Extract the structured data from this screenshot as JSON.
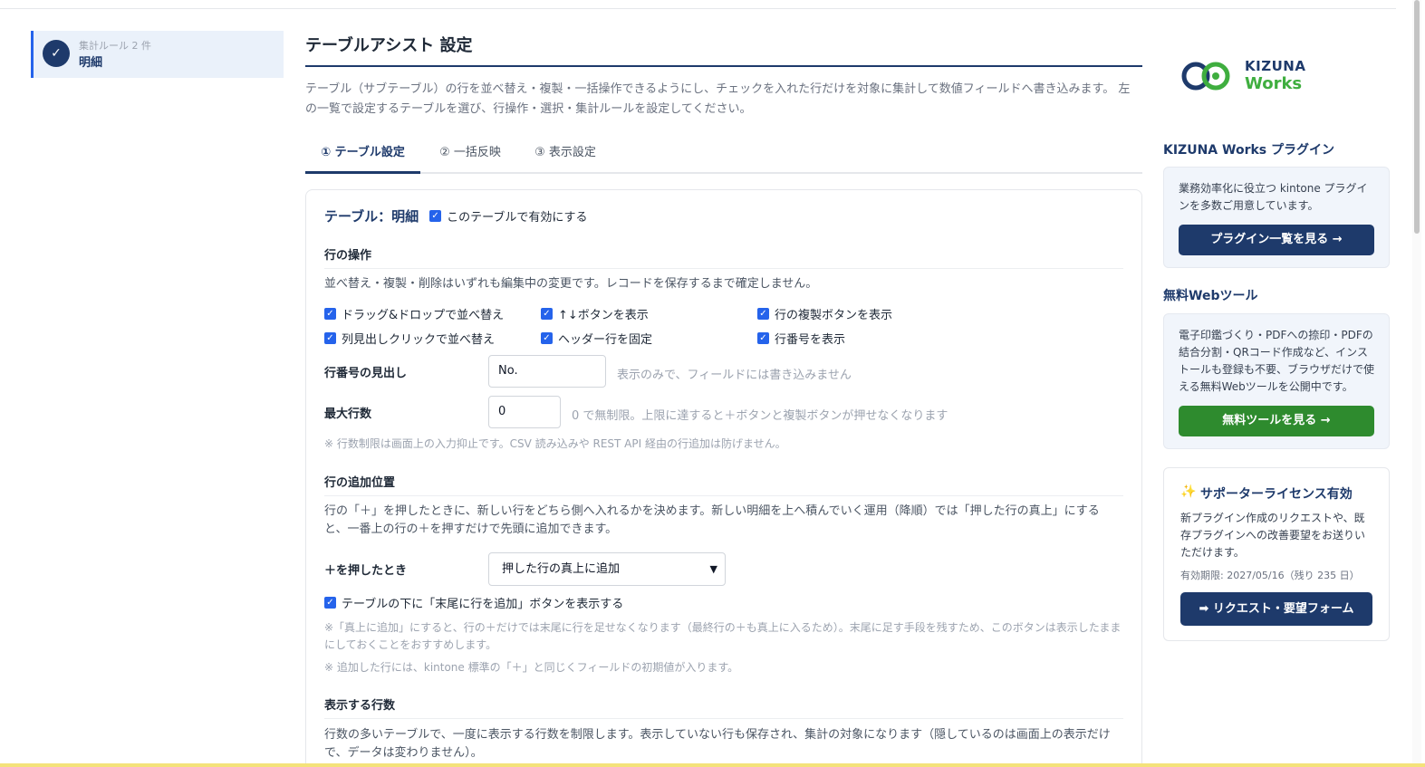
{
  "nav": {
    "rule_count": "集計ルール 2 件",
    "rule_name": "明細",
    "check_glyph": "✓"
  },
  "header": {
    "title": "テーブルアシスト 設定",
    "description": "テーブル（サブテーブル）の行を並べ替え・複製・一括操作できるようにし、チェックを入れた行だけを対象に集計して数値フィールドへ書き込みます。 左の一覧で設定するテーブルを選び、行操作・選択・集計ルールを設定してください。"
  },
  "tabs": [
    {
      "label": "① テーブル設定"
    },
    {
      "label": "② 一括反映"
    },
    {
      "label": "③ 表示設定"
    }
  ],
  "card": {
    "table_label": "テーブル：明細",
    "enable_label": "このテーブルで有効にする",
    "row_ops": {
      "title": "行の操作",
      "text": "並べ替え・複製・削除はいずれも編集中の変更です。レコードを保存するまで確定しません。",
      "options": [
        {
          "label": "ドラッグ&ドロップで並べ替え",
          "checked": true
        },
        {
          "label": "↑↓ボタンを表示",
          "checked": true
        },
        {
          "label": "行の複製ボタンを表示",
          "checked": true
        },
        {
          "label": "列見出しクリックで並べ替え",
          "checked": true
        },
        {
          "label": "ヘッダー行を固定",
          "checked": true
        },
        {
          "label": "行番号を表示",
          "checked": true
        }
      ]
    },
    "row_number_heading": {
      "label": "行番号の見出し",
      "value": "No.",
      "hint": "表示のみで、フィールドには書き込みません"
    },
    "max_rows": {
      "label": "最大行数",
      "value": "0",
      "hint": "0 で無制限。上限に達すると＋ボタンと複製ボタンが押せなくなります",
      "note": "※ 行数制限は画面上の入力抑止です。CSV 読み込みや REST API 経由の行追加は防げません。"
    },
    "add_position": {
      "title": "行の追加位置",
      "text": "行の「＋」を押したときに、新しい行をどちら側へ入れるかを決めます。新しい明細を上へ積んでいく運用（降順）では「押した行の真上」にすると、一番上の行の＋を押すだけで先頭に追加できます。",
      "select_label": "＋を押したとき",
      "select_value": "押した行の真上に追加",
      "footer_checkbox": "テーブルの下に「末尾に行を追加」ボタンを表示する",
      "note1": "※「真上に追加」にすると、行の＋だけでは末尾に行を足せなくなります（最終行の＋も真上に入るため）。末尾に足す手段を残すため、このボタンは表示したままにしておくことをおすすめします。",
      "note2": "※ 追加した行には、kintone 標準の「＋」と同じくフィールドの初期値が入ります。"
    },
    "visible_rows": {
      "title": "表示する行数",
      "text": "行数の多いテーブルで、一度に表示する行数を制限します。表示していない行も保存され、集計の対象になります（隠しているのは画面上の表示だけで、データは変わりません）。"
    }
  },
  "sidebar": {
    "logo_text_1": "KIZUNA",
    "logo_text_2": "Works",
    "plugins": {
      "title": "KIZUNA Works プラグイン",
      "text": "業務効率化に役立つ kintone プラグインを多数ご用意しています。",
      "button": "プラグイン一覧を見る →"
    },
    "tools": {
      "title": "無料Webツール",
      "text": "電子印鑑づくり・PDFへの捺印・PDFの結合分割・QRコード作成など、インストールも登録も不要、ブラウザだけで使える無料Webツールを公開中です。",
      "button": "無料ツールを見る →"
    },
    "support": {
      "icon": "✨",
      "title": "サポーターライセンス有効",
      "text": "新プラグイン作成のリクエストや、既存プラグインへの改善要望をお送りいただけます。",
      "expiry": "有効期限: 2027/05/16（残り 235 日）",
      "button": "➡ リクエスト・要望フォーム"
    }
  },
  "colors": {
    "navy": "#1e3a6b",
    "blue": "#2563eb",
    "green": "#2e8b2e",
    "logo_navy": "#1e3a6b",
    "logo_green": "#3fae3f"
  }
}
